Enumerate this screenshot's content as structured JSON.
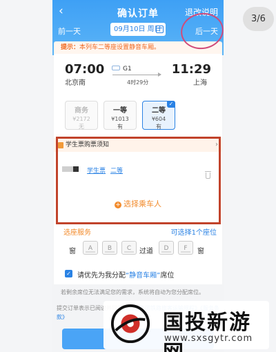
{
  "header": {
    "back_icon": "chevron-left-icon",
    "title": "确认订单",
    "refund_link": "退改说明",
    "prev_day": "前一天",
    "next_day": "后一天",
    "date": "09月10日 周日",
    "calendar_icon": "calendar-icon"
  },
  "tip": {
    "label": "提示：",
    "text": "本列车二等座设置静音车厢。"
  },
  "train": {
    "depart_time": "07:00",
    "depart_station": "北京南",
    "train_no": "G1",
    "duration": "4时29分",
    "arrive_time": "11:29",
    "arrive_station": "上海"
  },
  "seat_classes": [
    {
      "name": "商务",
      "price": "¥2172",
      "status": "无",
      "available": false,
      "selected": false
    },
    {
      "name": "一等",
      "price": "¥1013",
      "status": "有",
      "available": true,
      "selected": false
    },
    {
      "name": "二等",
      "price": "¥604",
      "status": "有",
      "available": true,
      "selected": true
    }
  ],
  "passenger": {
    "student_notice": "学生票购票须知",
    "ticket_type": "学生票",
    "seat_class": "二等",
    "choose_label": "选择乘车人"
  },
  "seat_selection": {
    "label": "选座服务",
    "count_text": "可选择1个座位",
    "window": "窗",
    "aisle": "过道",
    "seats": [
      "A",
      "B",
      "C",
      "D",
      "F"
    ]
  },
  "quiet_car": {
    "checked": true,
    "text_prefix": "请优先为我分配",
    "text_highlight": "“静音车厢”",
    "text_suffix": "席位",
    "note": "若剩余席位无法满足您的需求，系统将自动为您分配席位。"
  },
  "agreement": {
    "text": "提交订单表示已阅读并同意",
    "link": "《国铁集团铁路旅客运输规程》《服务条款》"
  },
  "pager": "3/6",
  "watermark": {
    "title": "国投新游网",
    "url": "www.sxsgytr.com"
  },
  "colors": {
    "primary": "#3ea0f5",
    "accent": "#f28a2a",
    "highlight_box": "#c1432b",
    "circle": "#d04b7a"
  }
}
